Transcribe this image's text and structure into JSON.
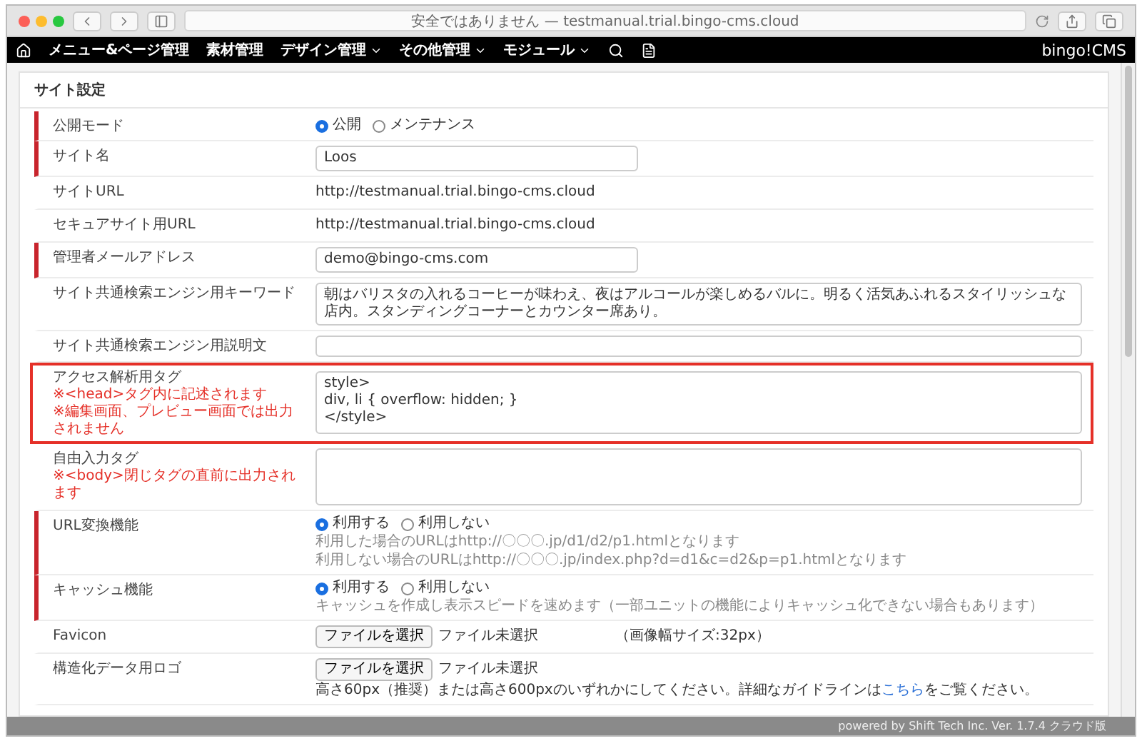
{
  "browser": {
    "address": "安全ではありません — testmanual.trial.bingo-cms.cloud"
  },
  "nav": {
    "items": [
      {
        "label": "メニュー&ページ管理",
        "dropdown": false
      },
      {
        "label": "素材管理",
        "dropdown": false
      },
      {
        "label": "デザイン管理",
        "dropdown": true
      },
      {
        "label": "その他管理",
        "dropdown": true
      },
      {
        "label": "モジュール",
        "dropdown": true
      }
    ],
    "brand": "bingo!CMS"
  },
  "card": {
    "title": "サイト設定"
  },
  "rows": [
    {
      "kind": "radio",
      "label": "公開モード",
      "required": true,
      "highlighted": false,
      "options": [
        {
          "label": "公開",
          "selected": true
        },
        {
          "label": "メンテナンス",
          "selected": false
        }
      ]
    },
    {
      "kind": "input",
      "label": "サイト名",
      "required": true,
      "highlighted": false,
      "value": "Loos"
    },
    {
      "kind": "text",
      "label": "サイトURL",
      "required": false,
      "highlighted": false,
      "value": "http://testmanual.trial.bingo-cms.cloud"
    },
    {
      "kind": "text",
      "label": "セキュアサイト用URL",
      "required": false,
      "highlighted": false,
      "value": "http://testmanual.trial.bingo-cms.cloud"
    },
    {
      "kind": "input",
      "label": "管理者メールアドレス",
      "required": true,
      "highlighted": false,
      "value": "demo@bingo-cms.com"
    },
    {
      "kind": "wide",
      "label": "サイト共通検索エンジン用キーワード",
      "required": false,
      "highlighted": false,
      "value": "朝はバリスタの入れるコーヒーが味わえ、夜はアルコールが楽しめるバルに。明るく活気あふれるスタイリッシュな店内。スタンディングコーナーとカウンター席あり。"
    },
    {
      "kind": "wide",
      "label": "サイト共通検索エンジン用説明文",
      "required": false,
      "highlighted": false
    },
    {
      "kind": "textarea",
      "label": "アクセス解析用タグ",
      "required": false,
      "highlighted": true,
      "notes": [
        "※<head>タグ内に記述されます",
        "※編集画面、プレビュー画面では出力されません"
      ],
      "value": "style>\ndiv, li { overflow: hidden; }\n</style>"
    },
    {
      "kind": "textarea",
      "label": "自由入力タグ",
      "required": false,
      "highlighted": false,
      "notes": [
        "※<body>閉じタグの直前に出力されます"
      ]
    },
    {
      "kind": "radio",
      "label": "URL変換機能",
      "required": true,
      "highlighted": false,
      "options": [
        {
          "label": "利用する",
          "selected": true
        },
        {
          "label": "利用しない",
          "selected": false
        }
      ],
      "help": [
        "利用した場合のURLはhttp://〇〇〇.jp/d1/d2/p1.htmlとなります",
        "利用しない場合のURLはhttp://〇〇〇.jp/index.php?d=d1&c=d2&p=p1.htmlとなります"
      ]
    },
    {
      "kind": "radio",
      "label": "キャッシュ機能",
      "required": true,
      "highlighted": false,
      "options": [
        {
          "label": "利用する",
          "selected": true
        },
        {
          "label": "利用しない",
          "selected": false
        }
      ],
      "help": [
        "キャッシュを作成し表示スピードを速めます（一部ユニットの機能によりキャッシュ化できない場合もあります）"
      ]
    },
    {
      "kind": "file",
      "label": "Favicon",
      "required": false,
      "highlighted": false,
      "button": "ファイルを選択",
      "status": "ファイル未選択",
      "hint": "（画像幅サイズ:32px）"
    },
    {
      "kind": "file",
      "label": "構造化データ用ロゴ",
      "required": false,
      "highlighted": false,
      "button": "ファイルを選択",
      "status": "ファイル未選択",
      "guide": {
        "before": "高さ60px（推奨）または高さ600pxのいずれかにしてください。詳細なガイドラインは",
        "link": "こちら",
        "after": "をご覧ください。"
      }
    }
  ],
  "footer": "powered by Shift Tech Inc. Ver. 1.7.4 クラウド版"
}
